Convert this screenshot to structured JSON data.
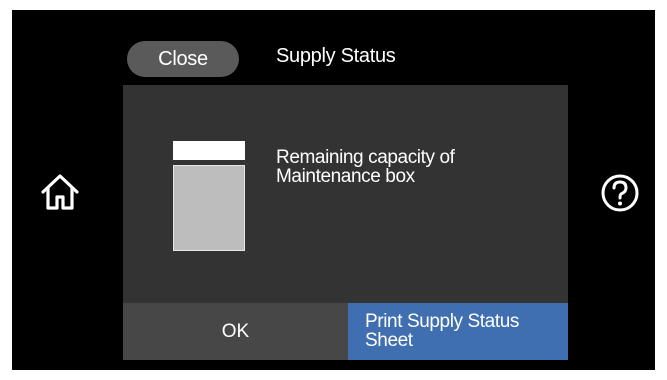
{
  "header": {
    "close_label": "Close",
    "title": "Supply Status"
  },
  "dialog": {
    "gauge_label": "Remaining capacity of Maintenance box",
    "gauge_remaining_fraction": 0.8,
    "ok_label": "OK",
    "print_label": "Print Supply Status Sheet"
  },
  "icons": {
    "home": "home-icon",
    "help": "help-icon"
  },
  "colors": {
    "screen_bg": "#000000",
    "dialog_bg": "#333333",
    "close_button_bg": "#5a5a5a",
    "ok_button_bg": "#474747",
    "print_button_bg": "#3f6fb0",
    "gauge_fill": "#bdbdbd"
  }
}
